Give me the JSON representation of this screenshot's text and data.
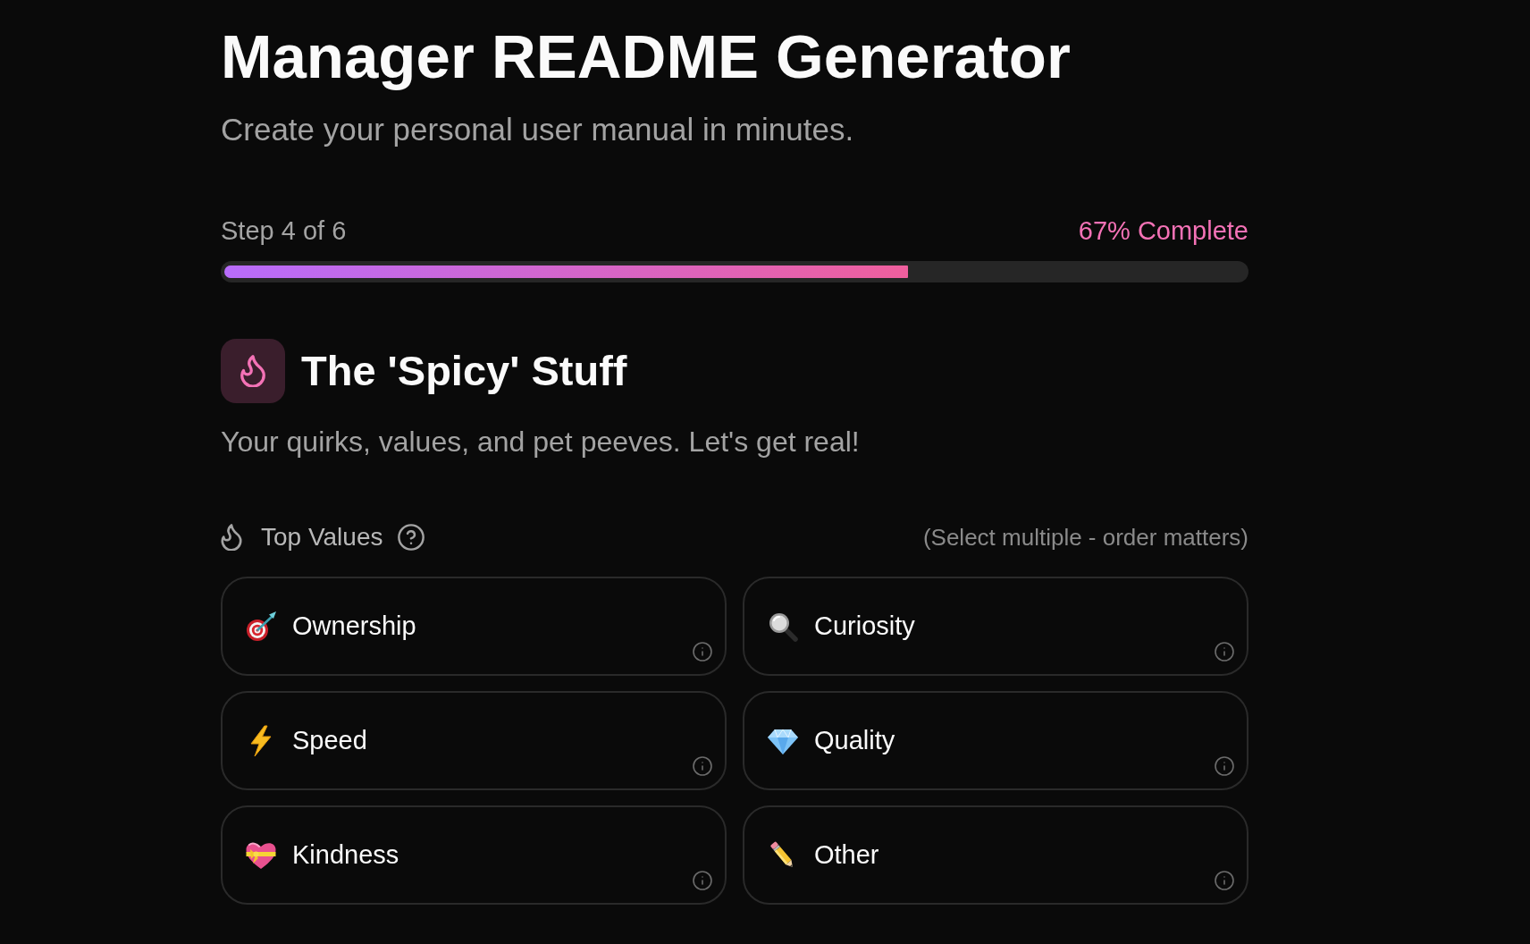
{
  "header": {
    "title": "Manager README Generator",
    "subtitle": "Create your personal user manual in minutes."
  },
  "progress": {
    "step": "Step 4 of 6",
    "percent": "67% Complete",
    "level": 0.67
  },
  "section": {
    "title": "The 'Spicy' Stuff",
    "description": "Your quirks, values, and pet peeves. Let's get real!"
  },
  "question": {
    "label": "Top Values",
    "hint": "(Select multiple - order matters)",
    "options": [
      {
        "label": "Ownership",
        "selected": false
      },
      {
        "label": "Curiosity",
        "selected": false
      },
      {
        "label": "Speed",
        "selected": false
      },
      {
        "label": "Quality",
        "selected": false
      },
      {
        "label": "Kindness",
        "selected": false
      },
      {
        "label": "Other",
        "selected": false
      }
    ]
  }
}
